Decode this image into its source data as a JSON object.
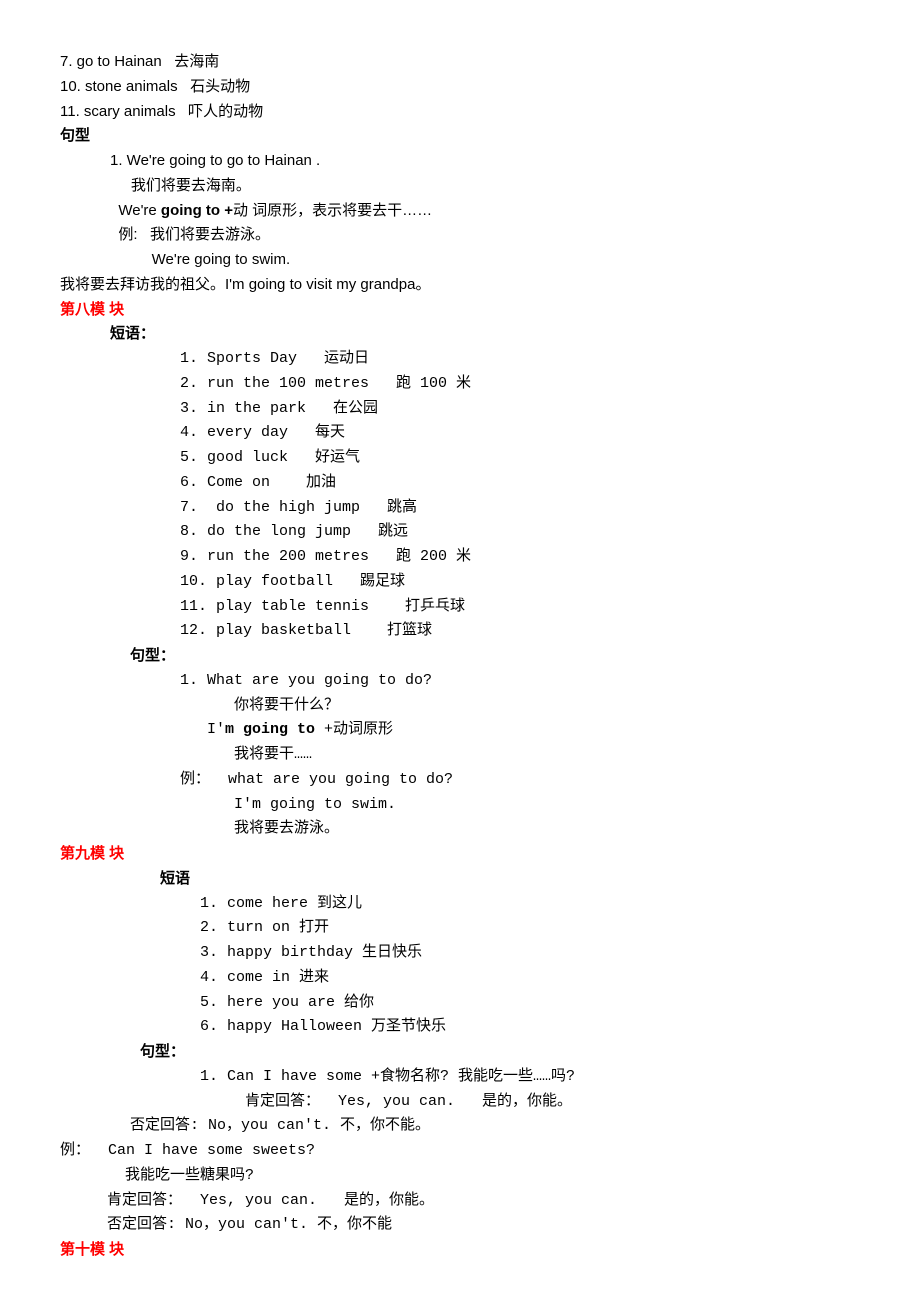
{
  "top_items": [
    "7. go to Hainan   去海南",
    "10. stone animals   石头动物",
    "11. scary animals   吓人的动物"
  ],
  "sentence_heading_1": "句型",
  "top_sentences": [
    "1. We're going to go to Hainan .",
    "     我们将要去海南。",
    "  We're going to +动 词原形，表示将要去干……",
    "  例:   我们将要去游泳。",
    "          We're going to swim."
  ],
  "top_example": "我将要去拜访我的祖父。I'm going to visit my grandpa。",
  "module8": {
    "title": "第八模 块",
    "phrase_heading": "短语：",
    "phrases": [
      "1. Sports Day   运动日",
      "2. run the 100 metres   跑 100 米",
      "3. in the park   在公园",
      "4. every day   每天",
      "5. good luck   好运气",
      "6. Come on    加油",
      "7.  do the high jump   跳高",
      "8. do the long jump   跳远",
      "9. run the 200 metres   跑 200 米",
      "10. play football   踢足球",
      "11. play table tennis    打乒乓球",
      "12. play basketball    打篮球"
    ],
    "sentence_heading": "句型：",
    "sentences": [
      "1. What are you going to do?",
      "      你将要干什么？",
      "   I'm going to +动词原形",
      "      我将要干……",
      "例：  what are you going to do?",
      "      I'm going to swim.",
      "      我将要去游泳。"
    ]
  },
  "module9": {
    "title": "第九模 块",
    "phrase_heading": "短语",
    "phrases": [
      "1. come here 到这儿",
      "2. turn on 打开",
      "3. happy birthday 生日快乐",
      "4. come in 进来",
      "5. here you are 给你",
      "6. happy Halloween 万圣节快乐"
    ],
    "sentence_heading": "句型：",
    "sentences": [
      "1. Can I have some +食物名称? 我能吃一些……吗?",
      "     肯定回答：  Yes, you can.   是的，你能。"
    ],
    "neg": "否定回答: No，you can't. 不，你不能。",
    "example": [
      "例：  Can I have some sweets?",
      "     我能吃一些糖果吗?",
      "   肯定回答：  Yes, you can.   是的，你能。",
      "   否定回答: No，you can't. 不，你不能"
    ]
  },
  "module10": {
    "title": "第十模 块"
  }
}
